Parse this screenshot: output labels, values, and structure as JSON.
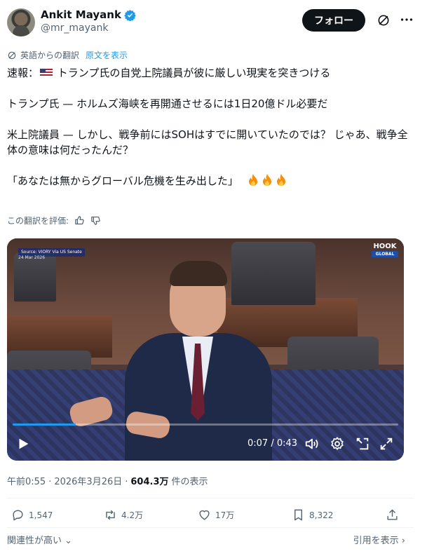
{
  "author": {
    "display_name": "Ankit Mayank",
    "handle": "@mr_mayank"
  },
  "follow_label": "フォロー",
  "translation": {
    "note": "英語からの翻訳",
    "show_original": "原文を表示",
    "rate_label": "この翻訳を評価:"
  },
  "tweet": {
    "line1_prefix": "速報：",
    "line1_rest": "トランプ氏の自党上院議員が彼に厳しい現実を突きつける",
    "line2": "トランプ氏 — ホルムズ海峡を再開通させるには1日20億ドル必要だ",
    "line3": "米上院議員 — しかし、戦争前にはSOHはすでに開いていたのでは？ じゃあ、戦争全体の意味は何だったんだ？",
    "line4": "「あなたは無からグローバル危機を生み出した」"
  },
  "video": {
    "source_label": "Source: VIORY Via US Senate",
    "source_date": "24 Mar 2026",
    "logo_top": "HOOK",
    "logo_bottom": "GLOBAL",
    "time": "0:07 / 0:43",
    "progress": 0.163
  },
  "meta": {
    "time": "午前0:55",
    "date": "2026年3月26日",
    "views": "604.3万",
    "views_suffix": "件の表示"
  },
  "actions": {
    "replies": "1,547",
    "reposts": "4.2万",
    "likes": "17万",
    "bookmarks": "8,322"
  },
  "footer": {
    "relevance": "関連性が高い",
    "quote": "引用を表示"
  },
  "colors": {
    "accent": "#1d9bf0",
    "text": "#0f1419",
    "muted": "#536471"
  }
}
